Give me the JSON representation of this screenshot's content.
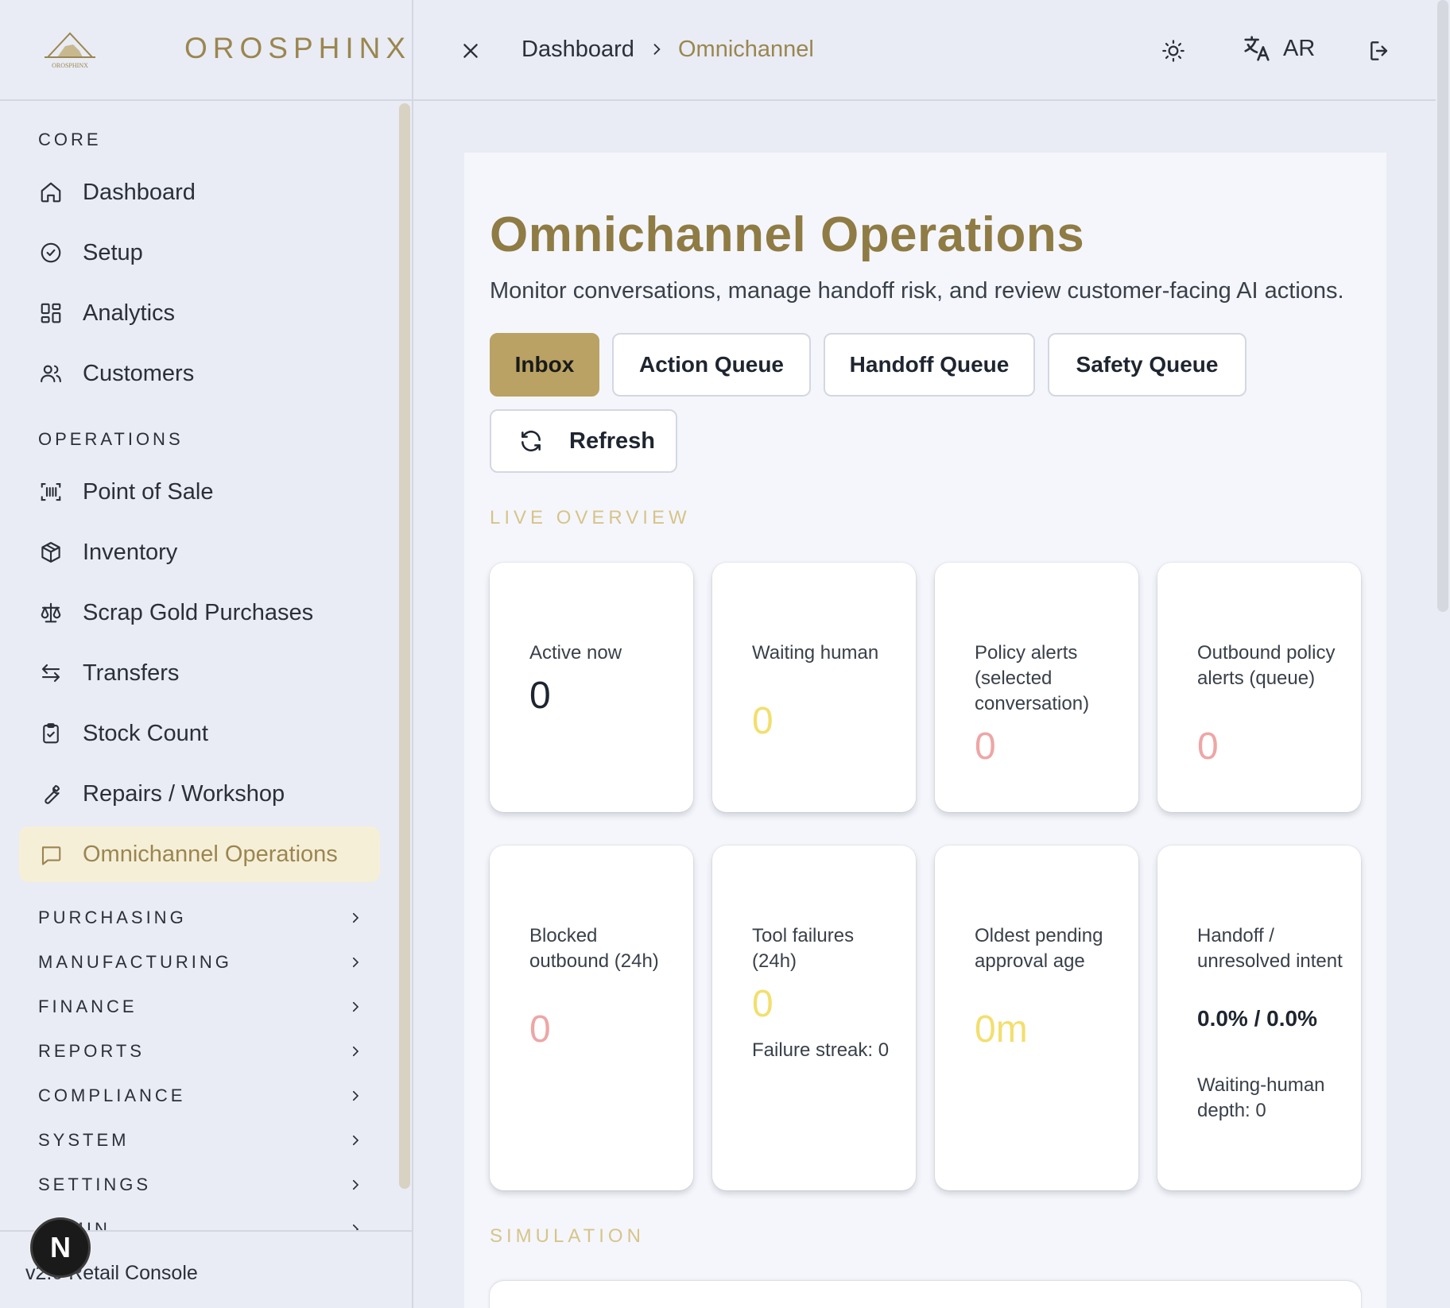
{
  "app": {
    "brand_name": "OROSPHINX",
    "logo_text": "OROSPHINX",
    "version_text": "v2.0 Retail Console",
    "avatar_letter": "N"
  },
  "sidebar": {
    "sections": {
      "core": "CORE",
      "operations": "OPERATIONS"
    },
    "core_items": [
      {
        "label": "Dashboard",
        "icon": "home-icon"
      },
      {
        "label": "Setup",
        "icon": "check-badge-icon"
      },
      {
        "label": "Analytics",
        "icon": "layout-grid-icon"
      },
      {
        "label": "Customers",
        "icon": "users-icon"
      }
    ],
    "operations_items": [
      {
        "label": "Point of Sale",
        "icon": "barcode-scan-icon"
      },
      {
        "label": "Inventory",
        "icon": "package-icon"
      },
      {
        "label": "Scrap Gold Purchases",
        "icon": "scale-icon"
      },
      {
        "label": "Transfers",
        "icon": "arrows-left-right-icon"
      },
      {
        "label": "Stock Count",
        "icon": "clipboard-check-icon"
      },
      {
        "label": "Repairs / Workshop",
        "icon": "wrench-icon"
      },
      {
        "label": "Omnichannel Operations",
        "icon": "message-square-icon",
        "active": true
      }
    ],
    "groups": [
      "PURCHASING",
      "MANUFACTURING",
      "FINANCE",
      "REPORTS",
      "COMPLIANCE",
      "SYSTEM",
      "SETTINGS",
      "ADMIN"
    ]
  },
  "topbar": {
    "breadcrumb_home": "Dashboard",
    "breadcrumb_current": "Omnichannel",
    "language_label": "AR"
  },
  "page": {
    "title": "Omnichannel Operations",
    "subtitle": "Monitor conversations, manage handoff risk, and review customer-facing AI actions.",
    "tabs": [
      {
        "label": "Inbox",
        "active": true
      },
      {
        "label": "Action Queue",
        "active": false
      },
      {
        "label": "Handoff Queue",
        "active": false
      },
      {
        "label": "Safety Queue",
        "active": false
      }
    ],
    "refresh_label": "Refresh",
    "live_overview_title": "LIVE OVERVIEW",
    "simulation_title": "SIMULATION"
  },
  "metrics": [
    {
      "label": "Active now",
      "value": "0",
      "value_color": "#1f2530"
    },
    {
      "label": "Waiting human",
      "value": "0",
      "value_color": "#f2df6e"
    },
    {
      "label": "Policy alerts (selected conversation)",
      "value": "0",
      "value_color": "#eea6a6"
    },
    {
      "label": "Outbound policy alerts (queue)",
      "value": "0",
      "value_color": "#eea6a6"
    },
    {
      "label": "Blocked outbound (24h)",
      "value": "0",
      "value_color": "#eea6a6"
    },
    {
      "label": "Tool failures (24h)",
      "value": "0",
      "value_color": "#f2df6e",
      "note": "Failure streak: 0"
    },
    {
      "label": "Oldest pending approval age",
      "value": "0m",
      "value_color": "#f2df6e"
    },
    {
      "label": "Handoff / unresolved intent",
      "value": "0.0% / 0.0%",
      "value_color": "#1f2530",
      "note": "Waiting-human depth: 0"
    }
  ],
  "colors": {
    "accent_gold": "#9a8650",
    "tab_active_bg": "#b9a263",
    "nav_active_bg": "#f6efd8",
    "warning_yellow": "#f2df6e",
    "danger_pink": "#eea6a6"
  }
}
